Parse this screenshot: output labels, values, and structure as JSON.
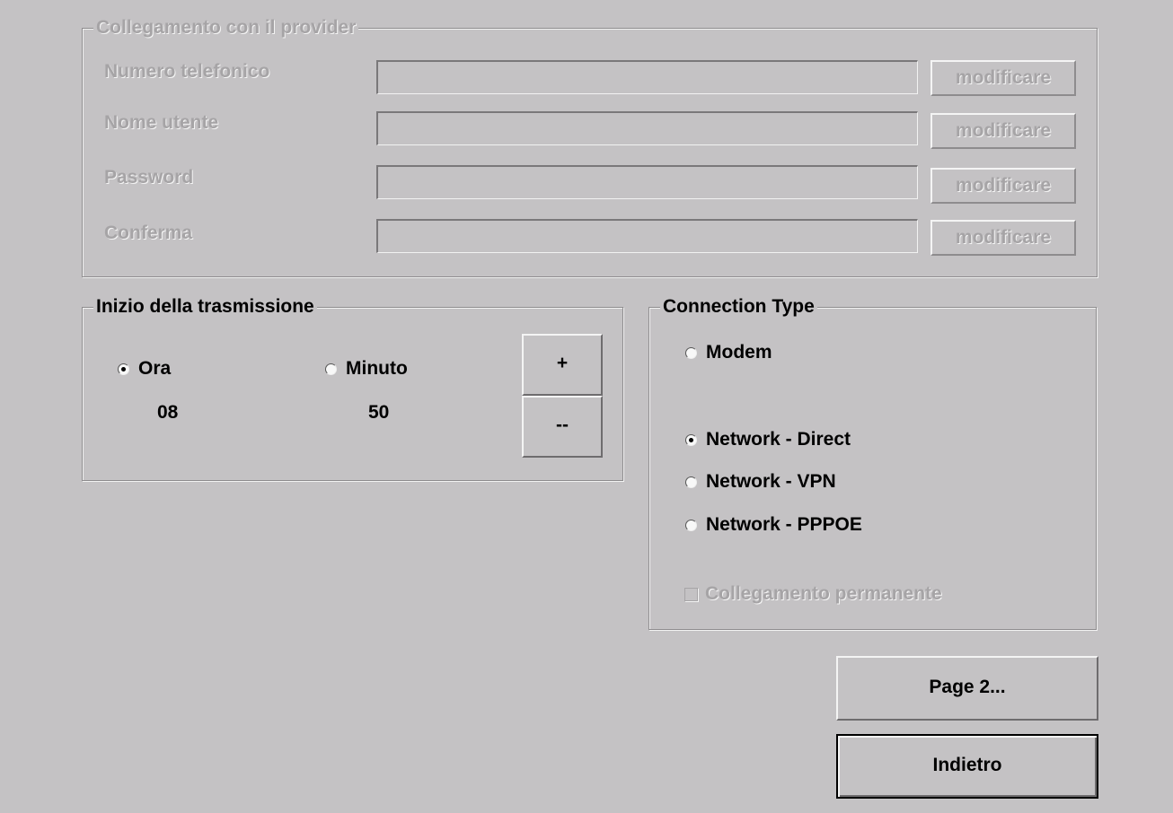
{
  "provider": {
    "title": "Collegamento con il provider",
    "fields": [
      {
        "label": "Numero telefonico",
        "value": "",
        "button": "modificare"
      },
      {
        "label": "Nome utente",
        "value": "",
        "button": "modificare"
      },
      {
        "label": "Password",
        "value": "",
        "button": "modificare"
      },
      {
        "label": "Conferma",
        "value": "",
        "button": "modificare"
      }
    ]
  },
  "transmission": {
    "title": "Inizio della trasmissione",
    "hour_label": "Ora",
    "minute_label": "Minuto",
    "hour_value": "08",
    "minute_value": "50",
    "selected": "Ora",
    "plus_label": "+",
    "minus_label": "--"
  },
  "connection": {
    "title": "Connection Type",
    "options": [
      {
        "label": "Modem",
        "checked": false
      },
      {
        "label": "Network - Direct",
        "checked": true
      },
      {
        "label": "Network - VPN",
        "checked": false
      },
      {
        "label": "Network - PPPOE",
        "checked": false
      }
    ],
    "permanent_label": "Collegamento permanente",
    "permanent_checked": false
  },
  "buttons": {
    "page2": "Page 2...",
    "back": "Indietro"
  },
  "colors": {
    "background": "#c4c2c4",
    "disabled_text": "#a6a4a6"
  }
}
